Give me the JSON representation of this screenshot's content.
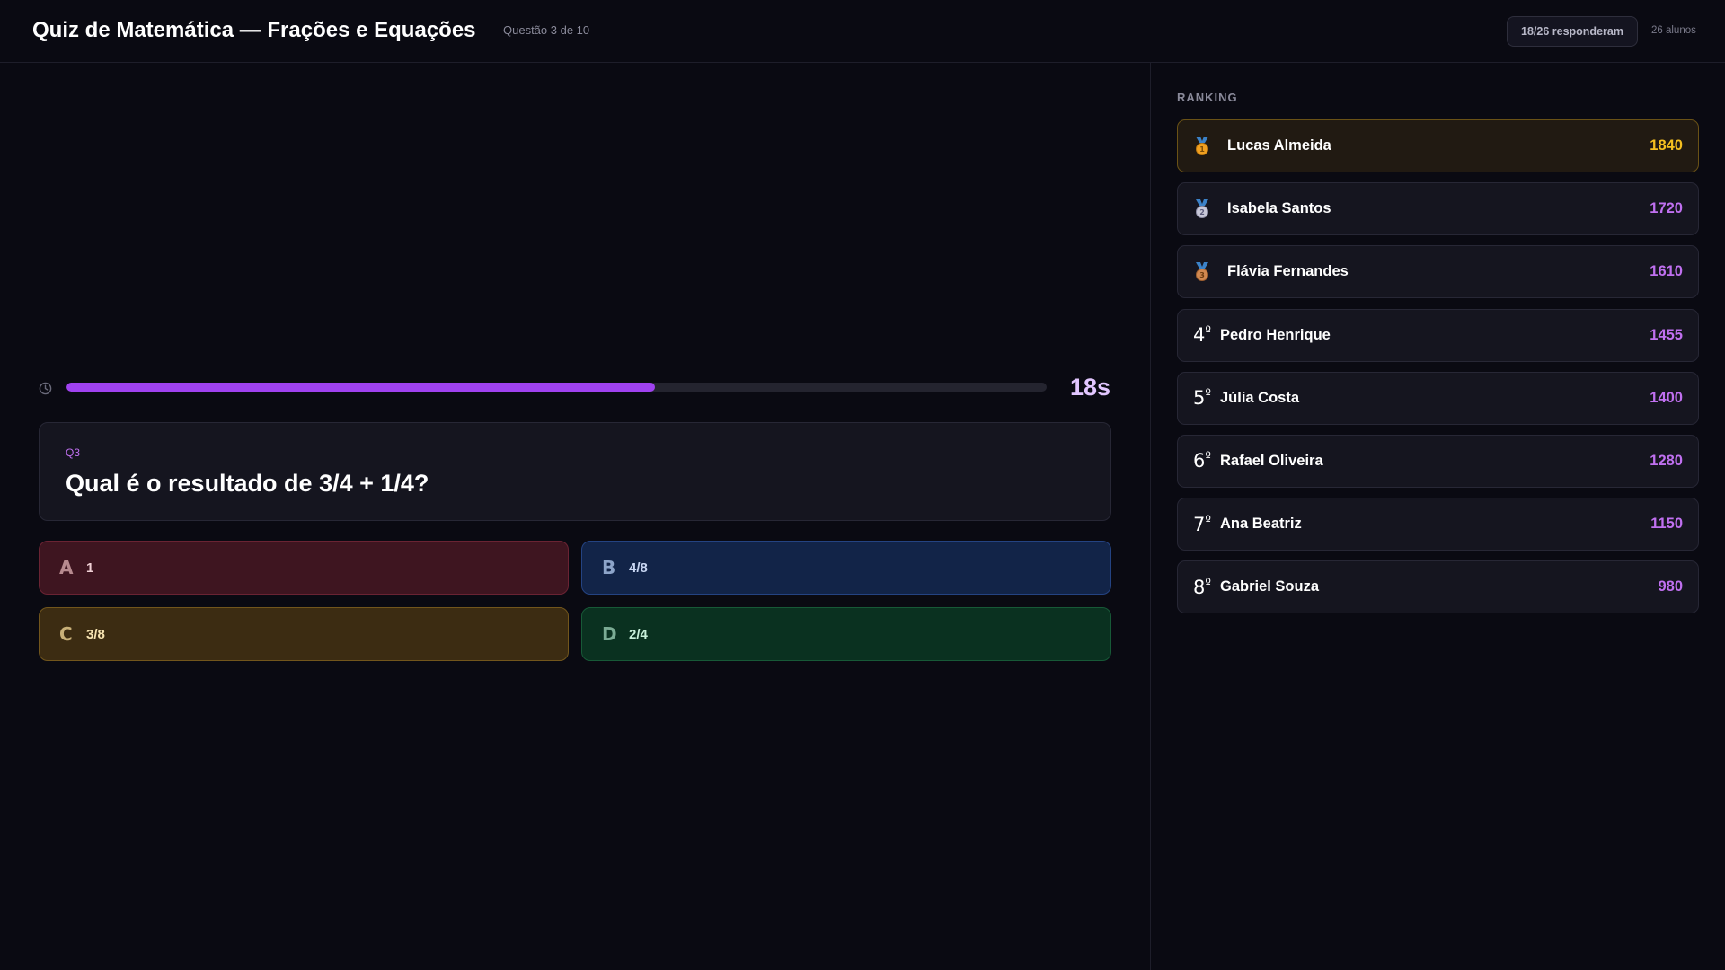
{
  "header": {
    "title": "Quiz de Matemática — Frações e Equações",
    "question_counter": "Questão 3 de 10",
    "responded": "18/26 responderam",
    "students": "26 alunos"
  },
  "timer": {
    "seconds_label": "18s",
    "progress_fraction": 0.6,
    "icon": "clock-icon"
  },
  "question": {
    "tag": "Q3",
    "text": "Qual é o resultado de 3/4 + 1/4?"
  },
  "options": [
    {
      "letter": "A",
      "text": "1",
      "color": "#3e1520"
    },
    {
      "letter": "B",
      "text": "4/8",
      "color": "#122448"
    },
    {
      "letter": "C",
      "text": "3/8",
      "color": "#3c2c12"
    },
    {
      "letter": "D",
      "text": "2/4",
      "color": "#0a3120"
    }
  ],
  "ranking": {
    "title": "RANKING",
    "rows": [
      {
        "medal": "gold-medal-icon",
        "medal_number": "1",
        "name": "Lucas Almeida",
        "score": "1840"
      },
      {
        "medal": "silver-medal-icon",
        "medal_number": "2",
        "name": "Isabela Santos",
        "score": "1720"
      },
      {
        "medal": "bronze-medal-icon",
        "medal_number": "3",
        "name": "Flávia Fernandes",
        "score": "1610"
      },
      {
        "position": "4",
        "ordinal": "º",
        "name": "Pedro Henrique",
        "score": "1455"
      },
      {
        "position": "5",
        "ordinal": "º",
        "name": "Júlia Costa",
        "score": "1400"
      },
      {
        "position": "6",
        "ordinal": "º",
        "name": "Rafael Oliveira",
        "score": "1280"
      },
      {
        "position": "7",
        "ordinal": "º",
        "name": "Ana Beatriz",
        "score": "1150"
      },
      {
        "position": "8",
        "ordinal": "º",
        "name": "Gabriel Souza",
        "score": "980"
      }
    ]
  },
  "colors": {
    "accent": "#a042f0",
    "gold": "#f5c020",
    "score": "#c070f0",
    "background": "#0a0a12"
  }
}
